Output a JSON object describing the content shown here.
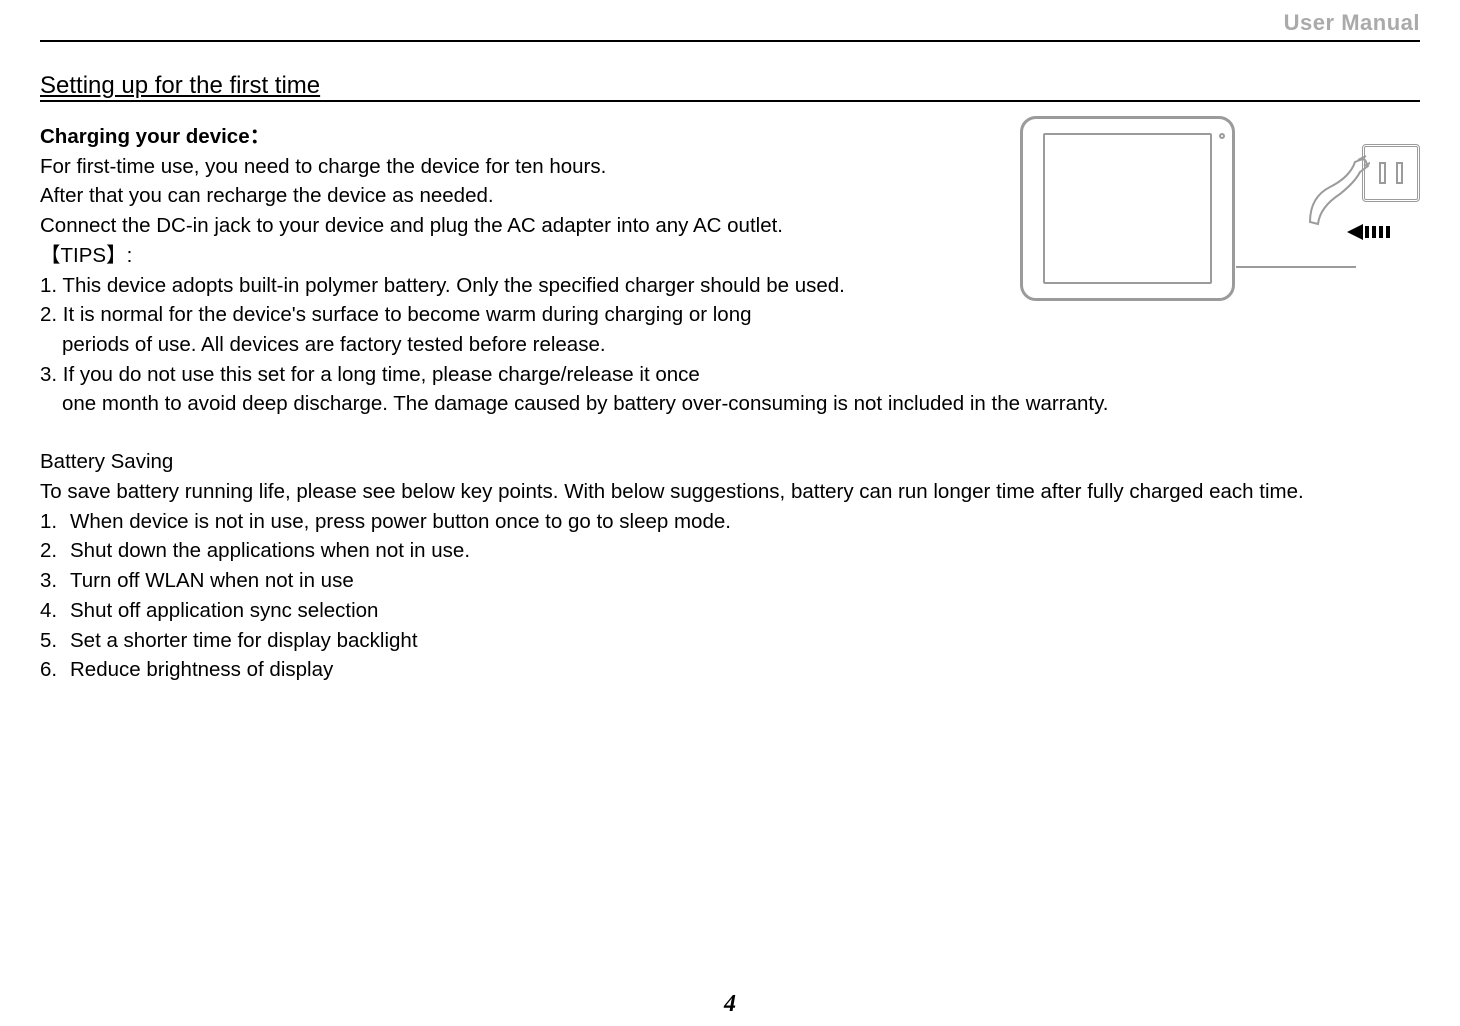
{
  "header_label": "User Manual",
  "section_title": "Setting up for the first time",
  "charging_heading": "Charging your device：",
  "charging_p1": "For first-time use, you need to charge the device for ten hours.",
  "charging_p2": "After that you can recharge the device as needed.",
  "charging_p3": "Connect the DC-in jack to your device and plug the AC adapter into any AC outlet.",
  "tips_label": "【TIPS】:",
  "tip1": "1. This device adopts built-in polymer battery. Only the specified charger should be used.",
  "tip2_line1": "2. It is normal for the device's surface to become warm during charging or long",
  "tip2_line2": "periods of use. All devices are factory tested before release.",
  "tip3_line1": "3. If you do not use this set for a long time, please charge/release it once",
  "tip3_line2": "one month to avoid deep discharge. The damage caused by battery over-consuming is not included in the warranty.",
  "battery_heading": "Battery Saving",
  "battery_intro": "To save battery running life, please see below key points. With below suggestions, battery can run longer time after fully charged each time.",
  "bs_items": [
    {
      "n": "1.",
      "t": "When device is not in use, press power button once to go to sleep mode."
    },
    {
      "n": "2.",
      "t": "Shut down the applications when not in use."
    },
    {
      "n": "3.",
      "t": "Turn off WLAN when not in use"
    },
    {
      "n": "4.",
      "t": "Shut off application sync selection"
    },
    {
      "n": "5.",
      "t": "Set a shorter time for display backlight"
    },
    {
      "n": "6.",
      "t": "Reduce brightness of display"
    }
  ],
  "page_number": "4"
}
